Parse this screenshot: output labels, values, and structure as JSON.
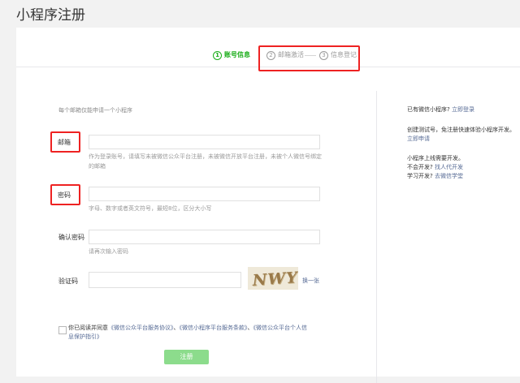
{
  "page": {
    "title": "小程序注册"
  },
  "steps": [
    {
      "num": "1",
      "label": "账号信息"
    },
    {
      "num": "2",
      "label": "邮箱激活"
    },
    {
      "num": "3",
      "label": "信息登记"
    }
  ],
  "form": {
    "intro": "每个邮箱仅能申请一个小程序",
    "email": {
      "label": "邮箱",
      "value": "",
      "hint": "作为登录账号，请填写未被微信公众平台注册，未被微信开放平台注册，未被个人微信号绑定的邮箱"
    },
    "password": {
      "label": "密码",
      "value": "",
      "hint": "字母、数字或者英文符号，最短8位，区分大小写"
    },
    "confirm": {
      "label": "确认密码",
      "value": "",
      "hint": "请再次输入密码"
    },
    "captcha": {
      "label": "验证码",
      "value": "",
      "image_text": "NWY",
      "refresh": "换一张"
    },
    "agreement": {
      "prefix": "你已阅读并同意",
      "link1": "《微信公众平台服务协议》",
      "sep": "、",
      "link2": "《微信小程序平台服务条款》",
      "link3": "《微信公众平台个人信息保护指引》"
    },
    "submit": "注册"
  },
  "sidebar": {
    "line1": "已有微信小程序?",
    "login": "立即登录",
    "line2": "创建测试号，免注册快速体验小程序开发。",
    "apply": "立即申请",
    "line3": "小程序上线需要开发。",
    "line4": "不会开发?",
    "find_dev": "找人代开发",
    "line5": "学习开发?",
    "academy": "去微信学堂"
  }
}
